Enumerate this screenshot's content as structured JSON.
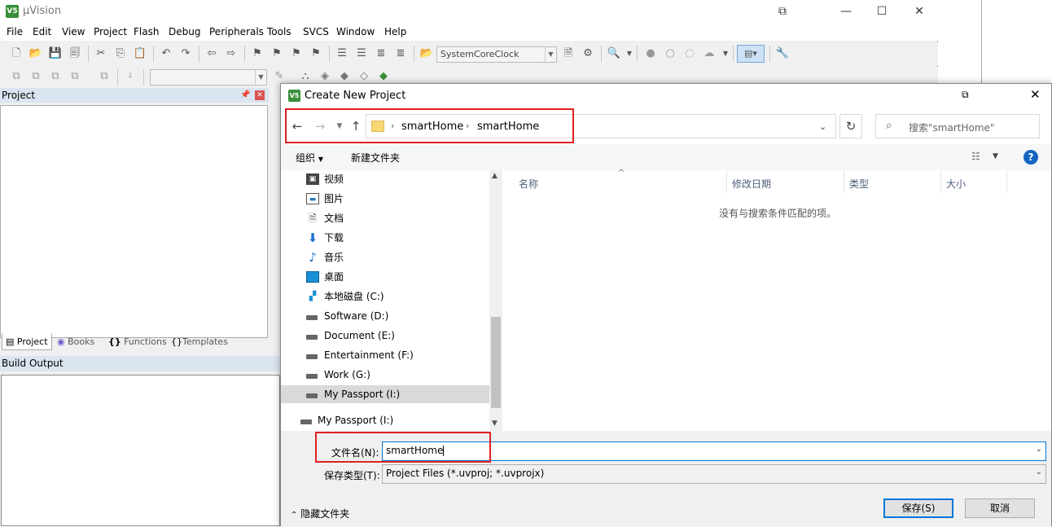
{
  "main_window": {
    "title": "μVision",
    "menu": [
      "File",
      "Edit",
      "View",
      "Project",
      "Flash",
      "Debug",
      "Peripherals",
      "Tools",
      "SVCS",
      "Window",
      "Help"
    ],
    "toolbar_combo": "SystemCoreClock",
    "project_panel": {
      "title": "Project",
      "tabs": [
        "Project",
        "Books",
        "Functions",
        "Templates"
      ]
    },
    "build_output_title": "Build Output"
  },
  "dialog": {
    "title": "Create New Project",
    "breadcrumb": [
      "smartHome",
      "smartHome"
    ],
    "search_placeholder": "搜索\"smartHome\"",
    "commands": {
      "organize": "组织",
      "new_folder": "新建文件夹"
    },
    "tree": [
      {
        "label": "视频",
        "icon": "video-icon"
      },
      {
        "label": "图片",
        "icon": "pictures-icon"
      },
      {
        "label": "文档",
        "icon": "documents-icon"
      },
      {
        "label": "下载",
        "icon": "download-icon"
      },
      {
        "label": "音乐",
        "icon": "music-icon"
      },
      {
        "label": "桌面",
        "icon": "desktop-icon"
      },
      {
        "label": "本地磁盘 (C:)",
        "icon": "local-disk-icon"
      },
      {
        "label": "Software (D:)",
        "icon": "drive-icon"
      },
      {
        "label": "Document (E:)",
        "icon": "drive-icon"
      },
      {
        "label": "Entertainment (F:)",
        "icon": "drive-icon"
      },
      {
        "label": "Work (G:)",
        "icon": "drive-icon"
      },
      {
        "label": "My Passport (I:)",
        "icon": "drive-icon",
        "selected": true
      }
    ],
    "tree_root_item": "My Passport (I:)",
    "columns": [
      "名称",
      "修改日期",
      "类型",
      "大小"
    ],
    "empty_message": "没有与搜索条件匹配的项。",
    "filename_label": "文件名(N):",
    "filename_value": "smartHome",
    "filetype_label": "保存类型(T):",
    "filetype_value": "Project Files (*.uvproj; *.uvprojx)",
    "hide_folders": "隐藏文件夹",
    "save_button": "保存(S)",
    "cancel_button": "取消"
  },
  "colors": {
    "highlight_box": "#e02020",
    "accent": "#0078d7",
    "help": "#1565c0"
  }
}
